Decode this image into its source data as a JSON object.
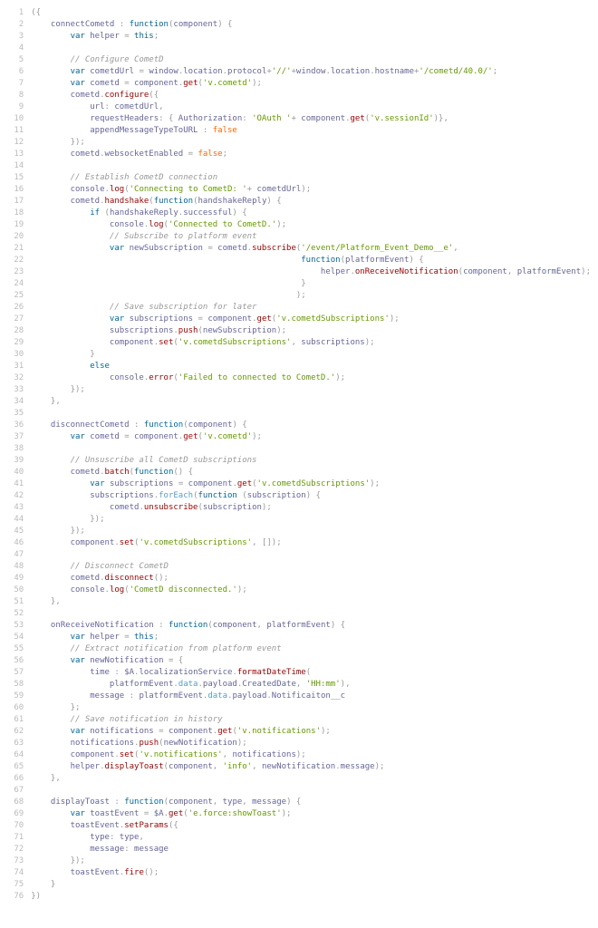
{
  "lines": [
    {
      "n": 1,
      "html": "<span class=\"pun\">({</span>"
    },
    {
      "n": 2,
      "html": "    <span class=\"key\">connectCometd</span> <span class=\"pun\">:</span> <span class=\"kw\">function</span><span class=\"pun\">(</span><span class=\"key\">component</span><span class=\"pun\">) {</span>"
    },
    {
      "n": 3,
      "html": "        <span class=\"kw\">var</span> <span class=\"key\">helper</span> <span class=\"pun\">=</span> <span class=\"kw\">this</span><span class=\"pun\">;</span>"
    },
    {
      "n": 4,
      "html": ""
    },
    {
      "n": 5,
      "html": "        <span class=\"cmt\">// Configure CometD</span>"
    },
    {
      "n": 6,
      "html": "        <span class=\"kw\">var</span> <span class=\"key\">cometdUrl</span> <span class=\"pun\">=</span> <span class=\"key\">window</span><span class=\"pun\">.</span><span class=\"key\">location</span><span class=\"pun\">.</span><span class=\"key\">protocol</span><span class=\"pun\">+</span><span class=\"str\">'//'</span><span class=\"pun\">+</span><span class=\"key\">window</span><span class=\"pun\">.</span><span class=\"key\">location</span><span class=\"pun\">.</span><span class=\"key\">hostname</span><span class=\"pun\">+</span><span class=\"str\">'/cometd/40.0/'</span><span class=\"pun\">;</span>"
    },
    {
      "n": 7,
      "html": "        <span class=\"kw\">var</span> <span class=\"key\">cometd</span> <span class=\"pun\">=</span> <span class=\"key\">component</span><span class=\"pun\">.</span><span class=\"fn\">get</span><span class=\"pun\">(</span><span class=\"str\">'v.cometd'</span><span class=\"pun\">);</span>"
    },
    {
      "n": 8,
      "html": "        <span class=\"key\">cometd</span><span class=\"pun\">.</span><span class=\"fn\">configure</span><span class=\"pun\">({</span>"
    },
    {
      "n": 9,
      "html": "            <span class=\"key\">url</span><span class=\"pun\">:</span> <span class=\"key\">cometdUrl</span><span class=\"pun\">,</span>"
    },
    {
      "n": 10,
      "html": "            <span class=\"key\">requestHeaders</span><span class=\"pun\">: {</span> <span class=\"key\">Authorization</span><span class=\"pun\">:</span> <span class=\"str\">'OAuth '</span><span class=\"pun\">+</span> <span class=\"key\">component</span><span class=\"pun\">.</span><span class=\"fn\">get</span><span class=\"pun\">(</span><span class=\"str\">'v.sessionId'</span><span class=\"pun\">)},</span>"
    },
    {
      "n": 11,
      "html": "            <span class=\"key\">appendMessageTypeToURL</span> <span class=\"pun\">:</span> <span class=\"lit\">false</span>"
    },
    {
      "n": 12,
      "html": "        <span class=\"pun\">});</span>"
    },
    {
      "n": 13,
      "html": "        <span class=\"key\">cometd</span><span class=\"pun\">.</span><span class=\"key\">websocketEnabled</span> <span class=\"pun\">=</span> <span class=\"lit\">false</span><span class=\"pun\">;</span>"
    },
    {
      "n": 14,
      "html": ""
    },
    {
      "n": 15,
      "html": "        <span class=\"cmt\">// Establish CometD connection</span>"
    },
    {
      "n": 16,
      "html": "        <span class=\"key\">console</span><span class=\"pun\">.</span><span class=\"fn\">log</span><span class=\"pun\">(</span><span class=\"str\">'Connecting to CometD: '</span><span class=\"pun\">+</span> <span class=\"key\">cometdUrl</span><span class=\"pun\">);</span>"
    },
    {
      "n": 17,
      "html": "        <span class=\"key\">cometd</span><span class=\"pun\">.</span><span class=\"fn\">handshake</span><span class=\"pun\">(</span><span class=\"kw\">function</span><span class=\"pun\">(</span><span class=\"key\">handshakeReply</span><span class=\"pun\">) {</span>"
    },
    {
      "n": 18,
      "html": "            <span class=\"kw\">if</span> <span class=\"pun\">(</span><span class=\"key\">handshakeReply</span><span class=\"pun\">.</span><span class=\"key\">successful</span><span class=\"pun\">) {</span>"
    },
    {
      "n": 19,
      "html": "                <span class=\"key\">console</span><span class=\"pun\">.</span><span class=\"fn\">log</span><span class=\"pun\">(</span><span class=\"str\">'Connected to CometD.'</span><span class=\"pun\">);</span>"
    },
    {
      "n": 20,
      "html": "                <span class=\"cmt\">// Subscribe to platform event</span>"
    },
    {
      "n": 21,
      "html": "                <span class=\"kw\">var</span> <span class=\"key\">newSubscription</span> <span class=\"pun\">=</span> <span class=\"key\">cometd</span><span class=\"pun\">.</span><span class=\"fn\">subscribe</span><span class=\"pun\">(</span><span class=\"str\">'/event/Platform_Event_Demo__e'</span><span class=\"pun\">,</span>"
    },
    {
      "n": 22,
      "html": "                                                       <span class=\"kw\">function</span><span class=\"pun\">(</span><span class=\"key\">platformEvent</span><span class=\"pun\">) {</span>"
    },
    {
      "n": 23,
      "html": "                                                           <span class=\"key\">helper</span><span class=\"pun\">.</span><span class=\"fn\">onReceiveNotification</span><span class=\"pun\">(</span><span class=\"key\">component</span><span class=\"pun\">,</span> <span class=\"key\">platformEvent</span><span class=\"pun\">);</span>"
    },
    {
      "n": 24,
      "html": "                                                       <span class=\"pun\">}</span>"
    },
    {
      "n": 25,
      "html": "                                                      <span class=\"pun\">);</span>"
    },
    {
      "n": 26,
      "html": "                <span class=\"cmt\">// Save subscription for later</span>"
    },
    {
      "n": 27,
      "html": "                <span class=\"kw\">var</span> <span class=\"key\">subscriptions</span> <span class=\"pun\">=</span> <span class=\"key\">component</span><span class=\"pun\">.</span><span class=\"fn\">get</span><span class=\"pun\">(</span><span class=\"str\">'v.cometdSubscriptions'</span><span class=\"pun\">);</span>"
    },
    {
      "n": 28,
      "html": "                <span class=\"key\">subscriptions</span><span class=\"pun\">.</span><span class=\"fn\">push</span><span class=\"pun\">(</span><span class=\"key\">newSubscription</span><span class=\"pun\">);</span>"
    },
    {
      "n": 29,
      "html": "                <span class=\"key\">component</span><span class=\"pun\">.</span><span class=\"fn\">set</span><span class=\"pun\">(</span><span class=\"str\">'v.cometdSubscriptions'</span><span class=\"pun\">,</span> <span class=\"key\">subscriptions</span><span class=\"pun\">);</span>"
    },
    {
      "n": 30,
      "html": "            <span class=\"pun\">}</span>"
    },
    {
      "n": 31,
      "html": "            <span class=\"kw\">else</span>"
    },
    {
      "n": 32,
      "html": "                <span class=\"key\">console</span><span class=\"pun\">.</span><span class=\"fn\">error</span><span class=\"pun\">(</span><span class=\"str\">'Failed to connected to CometD.'</span><span class=\"pun\">);</span>"
    },
    {
      "n": 33,
      "html": "        <span class=\"pun\">});</span>"
    },
    {
      "n": 34,
      "html": "    <span class=\"pun\">},</span>"
    },
    {
      "n": 35,
      "html": ""
    },
    {
      "n": 36,
      "html": "    <span class=\"key\">disconnectCometd</span> <span class=\"pun\">:</span> <span class=\"kw\">function</span><span class=\"pun\">(</span><span class=\"key\">component</span><span class=\"pun\">) {</span>"
    },
    {
      "n": 37,
      "html": "        <span class=\"kw\">var</span> <span class=\"key\">cometd</span> <span class=\"pun\">=</span> <span class=\"key\">component</span><span class=\"pun\">.</span><span class=\"fn\">get</span><span class=\"pun\">(</span><span class=\"str\">'v.cometd'</span><span class=\"pun\">);</span>"
    },
    {
      "n": 38,
      "html": ""
    },
    {
      "n": 39,
      "html": "        <span class=\"cmt\">// Unsuscribe all CometD subscriptions</span>"
    },
    {
      "n": 40,
      "html": "        <span class=\"key\">cometd</span><span class=\"pun\">.</span><span class=\"fn\">batch</span><span class=\"pun\">(</span><span class=\"kw\">function</span><span class=\"pun\">() {</span>"
    },
    {
      "n": 41,
      "html": "            <span class=\"kw\">var</span> <span class=\"key\">subscriptions</span> <span class=\"pun\">=</span> <span class=\"key\">component</span><span class=\"pun\">.</span><span class=\"fn\">get</span><span class=\"pun\">(</span><span class=\"str\">'v.cometdSubscriptions'</span><span class=\"pun\">);</span>"
    },
    {
      "n": 42,
      "html": "            <span class=\"key\">subscriptions</span><span class=\"pun\">.</span><span class=\"prp\">forEach</span><span class=\"pun\">(</span><span class=\"kw\">function</span> <span class=\"pun\">(</span><span class=\"key\">subscription</span><span class=\"pun\">) {</span>"
    },
    {
      "n": 43,
      "html": "                <span class=\"key\">cometd</span><span class=\"pun\">.</span><span class=\"fn\">unsubscribe</span><span class=\"pun\">(</span><span class=\"key\">subscription</span><span class=\"pun\">);</span>"
    },
    {
      "n": 44,
      "html": "            <span class=\"pun\">});</span>"
    },
    {
      "n": 45,
      "html": "        <span class=\"pun\">});</span>"
    },
    {
      "n": 46,
      "html": "        <span class=\"key\">component</span><span class=\"pun\">.</span><span class=\"fn\">set</span><span class=\"pun\">(</span><span class=\"str\">'v.cometdSubscriptions'</span><span class=\"pun\">,</span> <span class=\"pun\">[]);</span>"
    },
    {
      "n": 47,
      "html": ""
    },
    {
      "n": 48,
      "html": "        <span class=\"cmt\">// Disconnect CometD</span>"
    },
    {
      "n": 49,
      "html": "        <span class=\"key\">cometd</span><span class=\"pun\">.</span><span class=\"fn\">disconnect</span><span class=\"pun\">();</span>"
    },
    {
      "n": 50,
      "html": "        <span class=\"key\">console</span><span class=\"pun\">.</span><span class=\"fn\">log</span><span class=\"pun\">(</span><span class=\"str\">'CometD disconnected.'</span><span class=\"pun\">);</span>"
    },
    {
      "n": 51,
      "html": "    <span class=\"pun\">},</span>"
    },
    {
      "n": 52,
      "html": ""
    },
    {
      "n": 53,
      "html": "    <span class=\"key\">onReceiveNotification</span> <span class=\"pun\">:</span> <span class=\"kw\">function</span><span class=\"pun\">(</span><span class=\"key\">component</span><span class=\"pun\">,</span> <span class=\"key\">platformEvent</span><span class=\"pun\">) {</span>"
    },
    {
      "n": 54,
      "html": "        <span class=\"kw\">var</span> <span class=\"key\">helper</span> <span class=\"pun\">=</span> <span class=\"kw\">this</span><span class=\"pun\">;</span>"
    },
    {
      "n": 55,
      "html": "        <span class=\"cmt\">// Extract notification from platform event</span>"
    },
    {
      "n": 56,
      "html": "        <span class=\"kw\">var</span> <span class=\"key\">newNotification</span> <span class=\"pun\">= {</span>"
    },
    {
      "n": 57,
      "html": "            <span class=\"key\">time</span> <span class=\"pun\">:</span> <span class=\"key\">$A</span><span class=\"pun\">.</span><span class=\"key\">localizationService</span><span class=\"pun\">.</span><span class=\"fn\">formatDateTime</span><span class=\"pun\">(</span>"
    },
    {
      "n": 58,
      "html": "                <span class=\"key\">platformEvent</span><span class=\"pun\">.</span><span class=\"prp\">data</span><span class=\"pun\">.</span><span class=\"key\">payload</span><span class=\"pun\">.</span><span class=\"key\">CreatedDate</span><span class=\"pun\">,</span> <span class=\"str\">'HH:mm'</span><span class=\"pun\">),</span>"
    },
    {
      "n": 59,
      "html": "            <span class=\"key\">message</span> <span class=\"pun\">:</span> <span class=\"key\">platformEvent</span><span class=\"pun\">.</span><span class=\"prp\">data</span><span class=\"pun\">.</span><span class=\"key\">payload</span><span class=\"pun\">.</span><span class=\"key\">Notificaiton__c</span>"
    },
    {
      "n": 60,
      "html": "        <span class=\"pun\">};</span>"
    },
    {
      "n": 61,
      "html": "        <span class=\"cmt\">// Save notification in history</span>"
    },
    {
      "n": 62,
      "html": "        <span class=\"kw\">var</span> <span class=\"key\">notifications</span> <span class=\"pun\">=</span> <span class=\"key\">component</span><span class=\"pun\">.</span><span class=\"fn\">get</span><span class=\"pun\">(</span><span class=\"str\">'v.notifications'</span><span class=\"pun\">);</span>"
    },
    {
      "n": 63,
      "html": "        <span class=\"key\">notifications</span><span class=\"pun\">.</span><span class=\"fn\">push</span><span class=\"pun\">(</span><span class=\"key\">newNotification</span><span class=\"pun\">);</span>"
    },
    {
      "n": 64,
      "html": "        <span class=\"key\">component</span><span class=\"pun\">.</span><span class=\"fn\">set</span><span class=\"pun\">(</span><span class=\"str\">'v.notifications'</span><span class=\"pun\">,</span> <span class=\"key\">notifications</span><span class=\"pun\">);</span>"
    },
    {
      "n": 65,
      "html": "        <span class=\"key\">helper</span><span class=\"pun\">.</span><span class=\"fn\">displayToast</span><span class=\"pun\">(</span><span class=\"key\">component</span><span class=\"pun\">,</span> <span class=\"str\">'info'</span><span class=\"pun\">,</span> <span class=\"key\">newNotification</span><span class=\"pun\">.</span><span class=\"key\">message</span><span class=\"pun\">);</span>"
    },
    {
      "n": 66,
      "html": "    <span class=\"pun\">},</span>"
    },
    {
      "n": 67,
      "html": ""
    },
    {
      "n": 68,
      "html": "    <span class=\"key\">displayToast</span> <span class=\"pun\">:</span> <span class=\"kw\">function</span><span class=\"pun\">(</span><span class=\"key\">component</span><span class=\"pun\">,</span> <span class=\"key\">type</span><span class=\"pun\">,</span> <span class=\"key\">message</span><span class=\"pun\">) {</span>"
    },
    {
      "n": 69,
      "html": "        <span class=\"kw\">var</span> <span class=\"key\">toastEvent</span> <span class=\"pun\">=</span> <span class=\"key\">$A</span><span class=\"pun\">.</span><span class=\"fn\">get</span><span class=\"pun\">(</span><span class=\"str\">'e.force:showToast'</span><span class=\"pun\">);</span>"
    },
    {
      "n": 70,
      "html": "        <span class=\"key\">toastEvent</span><span class=\"pun\">.</span><span class=\"fn\">setParams</span><span class=\"pun\">({</span>"
    },
    {
      "n": 71,
      "html": "            <span class=\"key\">type</span><span class=\"pun\">:</span> <span class=\"key\">type</span><span class=\"pun\">,</span>"
    },
    {
      "n": 72,
      "html": "            <span class=\"key\">message</span><span class=\"pun\">:</span> <span class=\"key\">message</span>"
    },
    {
      "n": 73,
      "html": "        <span class=\"pun\">});</span>"
    },
    {
      "n": 74,
      "html": "        <span class=\"key\">toastEvent</span><span class=\"pun\">.</span><span class=\"fn\">fire</span><span class=\"pun\">();</span>"
    },
    {
      "n": 75,
      "html": "    <span class=\"pun\">}</span>"
    },
    {
      "n": 76,
      "html": "<span class=\"pun\">})</span>"
    }
  ]
}
